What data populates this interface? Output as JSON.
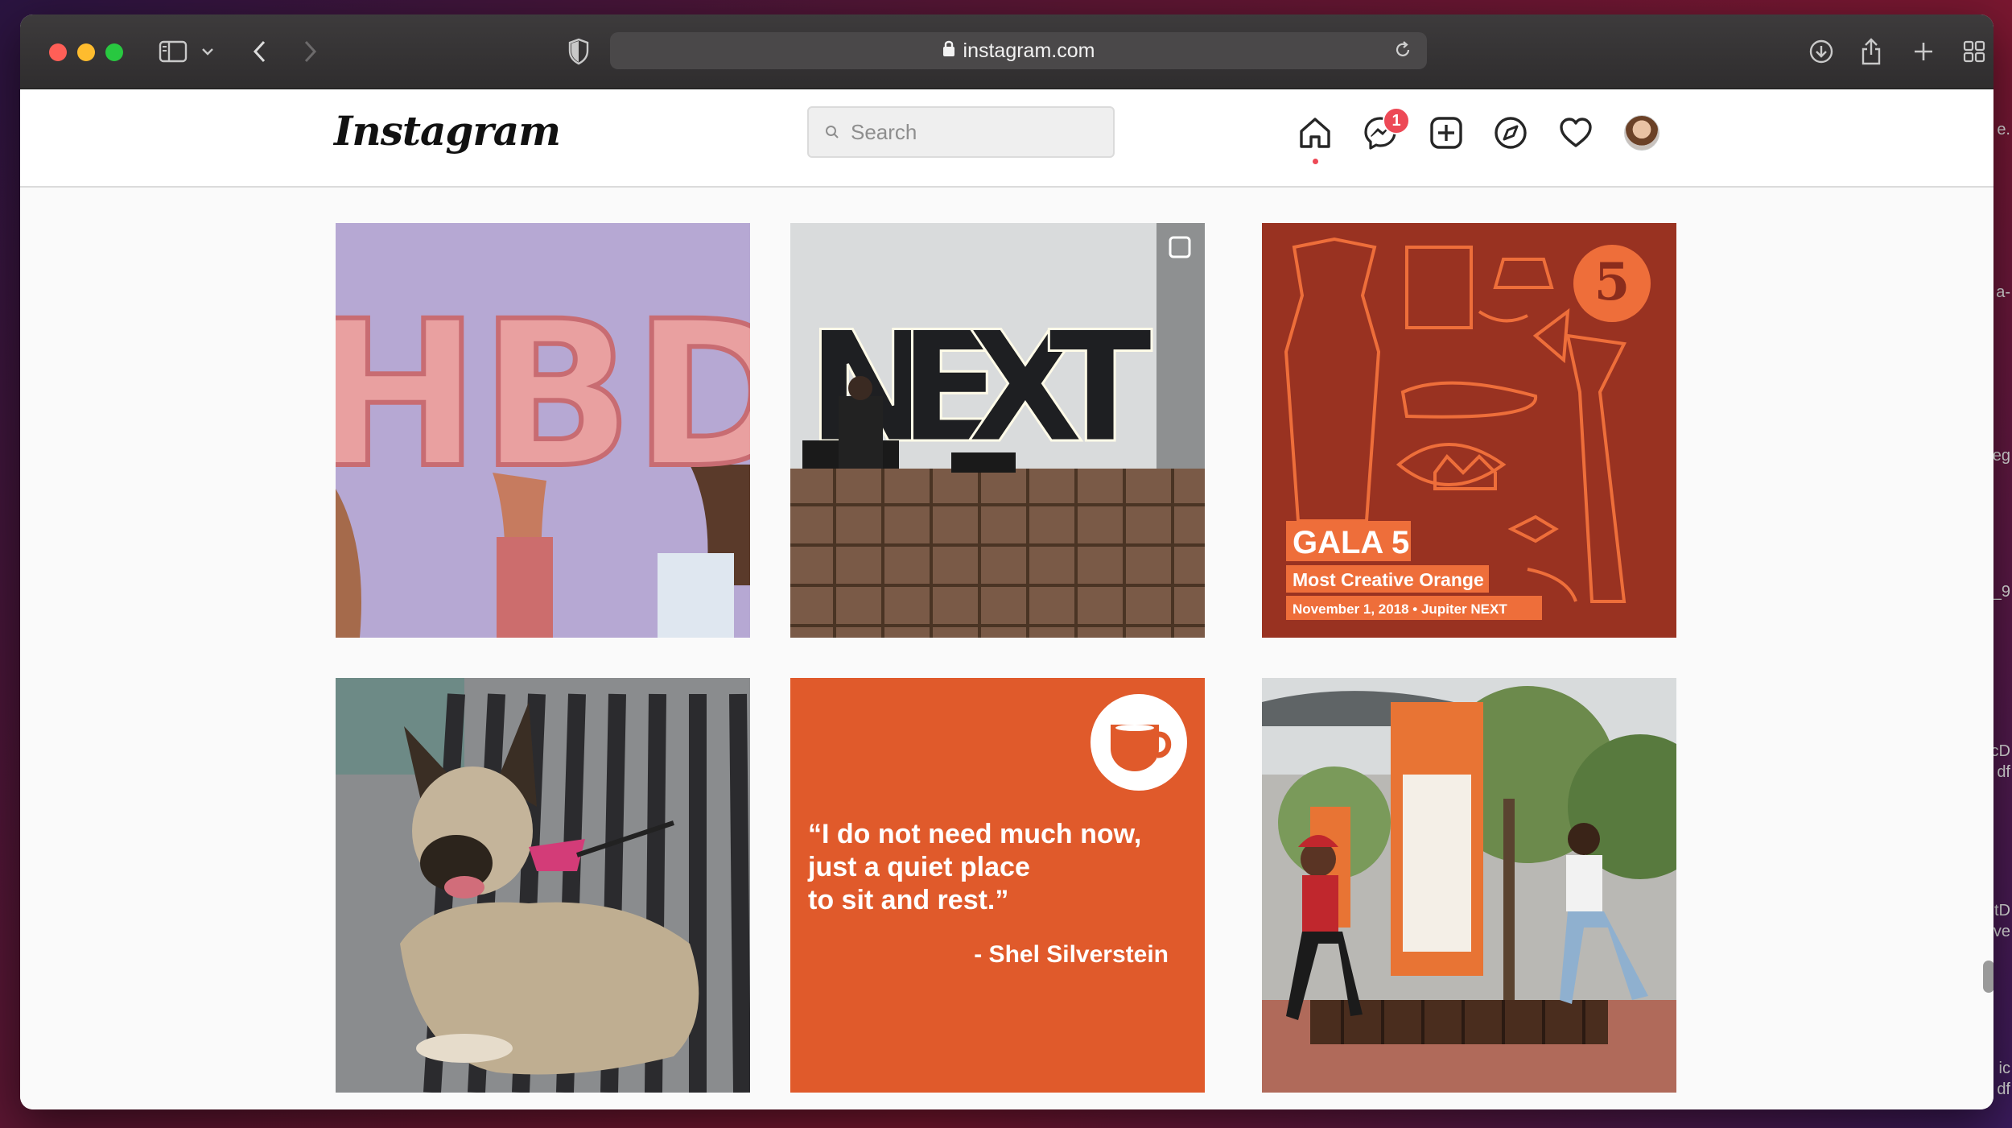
{
  "browser": {
    "url": "instagram.com"
  },
  "instagram": {
    "logo": "Instagram",
    "search_placeholder": "Search",
    "messages_badge": "1"
  },
  "posts": {
    "gala": {
      "number": "5",
      "title": "GALA 5",
      "subtitle": "Most Creative Orange",
      "date": "November 1, 2018 • Jupiter NEXT"
    },
    "next": {
      "sign": "NEXT"
    },
    "hbd": {
      "letters": "HBD"
    },
    "quote": {
      "line1": "“I do not need much now,",
      "line2": "just a quiet place",
      "line3": "to sit and rest.”",
      "author": "- Shel Silverstein"
    }
  },
  "desktop_peek": [
    "e.",
    "a-",
    "eg",
    "_9",
    "cD",
    "df",
    "tD",
    "ve",
    "ic",
    "df"
  ],
  "colors": {
    "accent": "#ed4956",
    "quote_bg": "#e05a2b",
    "gala_bg": "#993221"
  }
}
